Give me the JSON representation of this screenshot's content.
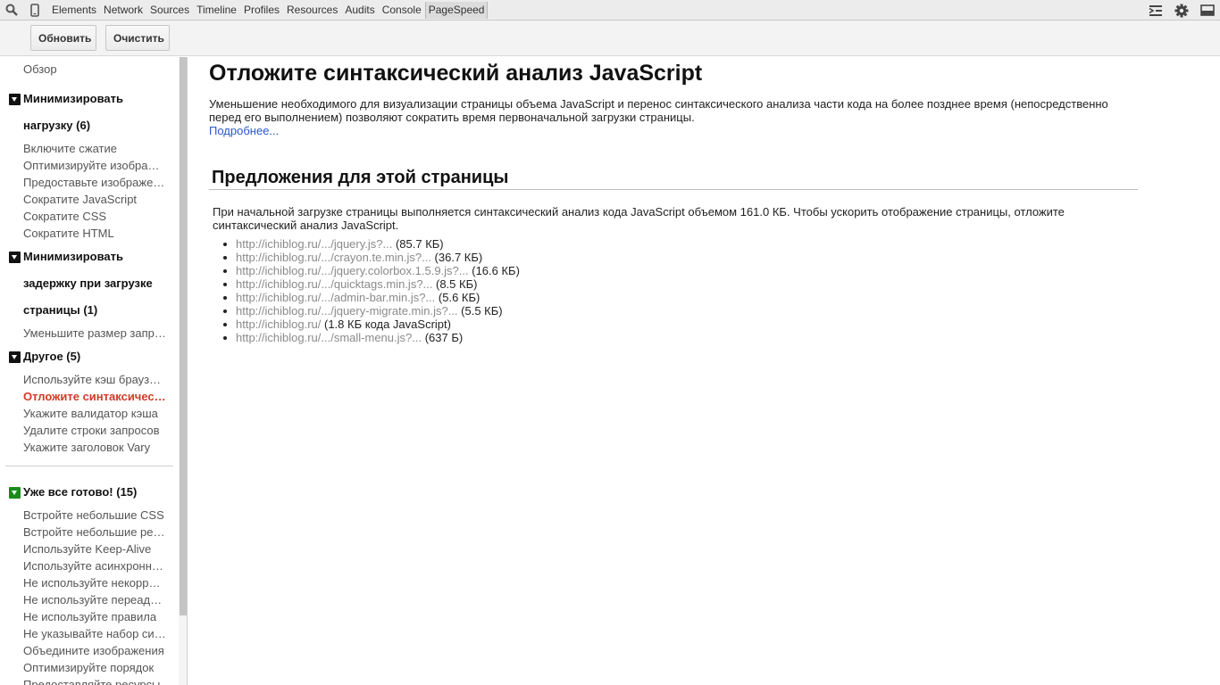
{
  "tabbar": {
    "tabs": [
      "Elements",
      "Network",
      "Sources",
      "Timeline",
      "Profiles",
      "Resources",
      "Audits",
      "Console",
      "PageSpeed"
    ],
    "active": "PageSpeed"
  },
  "icons": {
    "search": "search-icon",
    "device": "mobile-device-icon",
    "drawer": "show-drawer-icon",
    "settings": "gear-icon",
    "dock": "dock-side-icon"
  },
  "toolbar": {
    "refresh_label": "Обновить",
    "clear_label": "Очистить"
  },
  "sidebar": {
    "overview": "Обзор",
    "group1": {
      "title_l1": "Минимизировать",
      "title_l2": "нагрузку (6)",
      "items": [
        "Включите сжатие",
        "Оптимизируйте изображения",
        "Предоставьте изображения",
        "Сократите JavaScript",
        "Сократите CSS",
        "Сократите HTML"
      ]
    },
    "group2": {
      "title_l1": "Минимизировать",
      "title_l2": "задержку при загрузке",
      "title_l3": "страницы (1)",
      "items": [
        "Уменьшите размер запросов"
      ]
    },
    "group3": {
      "title": "Другое (5)",
      "items": [
        "Используйте кэш браузера",
        "Отложите синтаксический анализ",
        "Укажите валидатор кэша",
        "Удалите строки запросов",
        "Укажите заголовок Vary"
      ]
    },
    "group4": {
      "title": "Уже все готово! (15)",
      "items": [
        "Встройте небольшие CSS",
        "Встройте небольшие ресурсы",
        "Используйте Keep-Alive",
        "Используйте асинхронные",
        "Не используйте некорректные",
        "Не используйте переадресацию",
        "Не используйте правила",
        "Не указывайте набор символов",
        "Объедините изображения",
        "Оптимизируйте порядок",
        "Предоставляйте ресурсы"
      ]
    }
  },
  "main": {
    "title": "Отложите синтаксический анализ JavaScript",
    "description": "Уменьшение необходимого для визуализации страницы объема JavaScript и перенос синтаксического анализа части кода на более позднее время (непосредственно перед его выполнением) позволяют сократить время первоначальной загрузки страницы.",
    "more_link": "Подробнее...",
    "suggestions_title": "Предложения для этой страницы",
    "suggestions_text": "При начальной загрузке страницы выполняется синтаксический анализ кода JavaScript объемом 161.0 КБ. Чтобы ускорить отображение страницы, отложите синтаксический анализ JavaScript.",
    "resources": [
      {
        "url": "http://ichiblog.ru/.../jquery.js?...",
        "size": " (85.7 КБ)"
      },
      {
        "url": "http://ichiblog.ru/.../crayon.te.min.js?...",
        "size": " (36.7 КБ)"
      },
      {
        "url": "http://ichiblog.ru/.../jquery.colorbox.1.5.9.js?...",
        "size": " (16.6 КБ)"
      },
      {
        "url": "http://ichiblog.ru/.../quicktags.min.js?...",
        "size": " (8.5 КБ)"
      },
      {
        "url": "http://ichiblog.ru/.../admin-bar.min.js?...",
        "size": " (5.6 КБ)"
      },
      {
        "url": "http://ichiblog.ru/.../jquery-migrate.min.js?...",
        "size": " (5.5 КБ)"
      },
      {
        "url": "http://ichiblog.ru/",
        "size": " (1.8 КБ кода JavaScript)"
      },
      {
        "url": "http://ichiblog.ru/.../small-menu.js?...",
        "size": " (637 Б)"
      }
    ]
  }
}
